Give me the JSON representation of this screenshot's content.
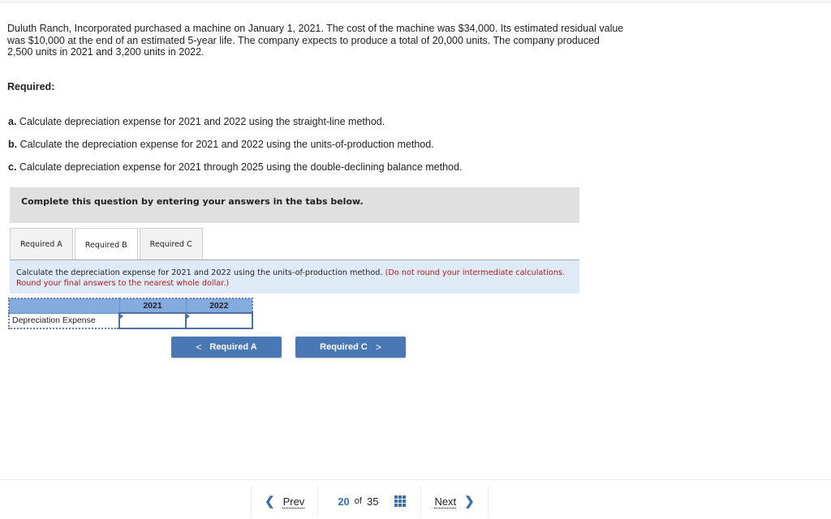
{
  "problem": {
    "text": "Duluth Ranch, Incorporated purchased a machine on January 1, 2021. The cost of the machine was $34,000. Its estimated residual value was $10,000 at the end of an estimated 5-year life. The company expects to produce a total of 20,000 units. The company produced 2,500 units in 2021 and 3,200 units in 2022."
  },
  "required": {
    "heading": "Required:",
    "items": [
      {
        "letter": "a.",
        "text": " Calculate depreciation expense for 2021 and 2022 using the straight-line method."
      },
      {
        "letter": "b.",
        "text": " Calculate the depreciation expense for 2021 and 2022 using the units-of-production method."
      },
      {
        "letter": "c.",
        "text": " Calculate depreciation expense for 2021 through 2025 using the double-declining balance method."
      }
    ]
  },
  "instruction": "Complete this question by entering your answers in the tabs below.",
  "tabs": [
    {
      "label": "Required A",
      "active": false
    },
    {
      "label": "Required B",
      "active": true
    },
    {
      "label": "Required C",
      "active": false
    }
  ],
  "panel": {
    "text": "Calculate the depreciation expense for 2021 and 2022 using the units-of-production method. ",
    "note": "(Do not round your intermediate calculations. Round your final answers to the nearest whole dollar.)"
  },
  "table": {
    "columns": [
      "",
      "2021",
      "2022"
    ],
    "rows": [
      {
        "label": "Depreciation Expense",
        "values": [
          "",
          ""
        ]
      }
    ]
  },
  "nav_buttons": {
    "prev_label": "Required A",
    "next_label": "Required C",
    "prev_chevron": "<",
    "next_chevron": ">"
  },
  "footer": {
    "prev_label": "Prev",
    "next_label": "Next",
    "current_page": "20",
    "of_label": "of",
    "total_pages": "35",
    "prev_icon": "chevron-left-icon",
    "next_icon": "chevron-right-icon",
    "grid_icon": "grid-icon"
  },
  "colors": {
    "accent": "#4a78b5",
    "note_red": "#b01c1c",
    "panel_bg": "#dfeaf7",
    "table_header": "#84abe0",
    "instruction_bg": "#e0e0e0"
  }
}
